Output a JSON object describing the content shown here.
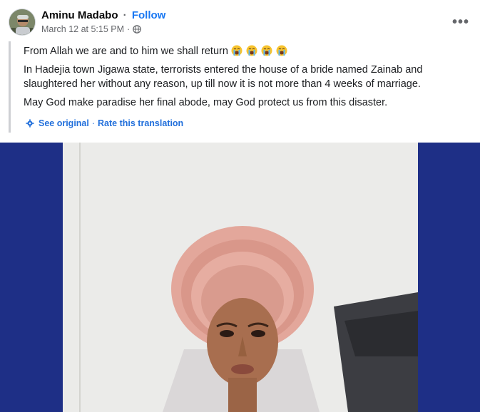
{
  "post": {
    "author": "Aminu Madabo",
    "separator": "·",
    "follow_label": "Follow",
    "timestamp": "March 12 at 5:15 PM",
    "audience_icon": "globe-icon",
    "more_icon": "more-options-icon",
    "body": {
      "line1": "From Allah we are and to him we shall return",
      "line1_emoji_count": 4,
      "line1_emoji": "loudly-crying-face",
      "paragraph2": "In Hadejia town Jigawa state, terrorists entered the house of a bride named Zainab and slaughtered her without any reason, up till now it is not more than 4 weeks of marriage.",
      "paragraph3": "May God make paradise her final abode, may God protect us from this disaster."
    },
    "translation": {
      "see_original": "See original",
      "separator": "·",
      "rate": "Rate this translation"
    }
  },
  "colors": {
    "link_blue": "#1877f2",
    "meta_gray": "#65676b",
    "photo_background": "#1e2f86",
    "headwrap_pink": "#e3a79b"
  }
}
